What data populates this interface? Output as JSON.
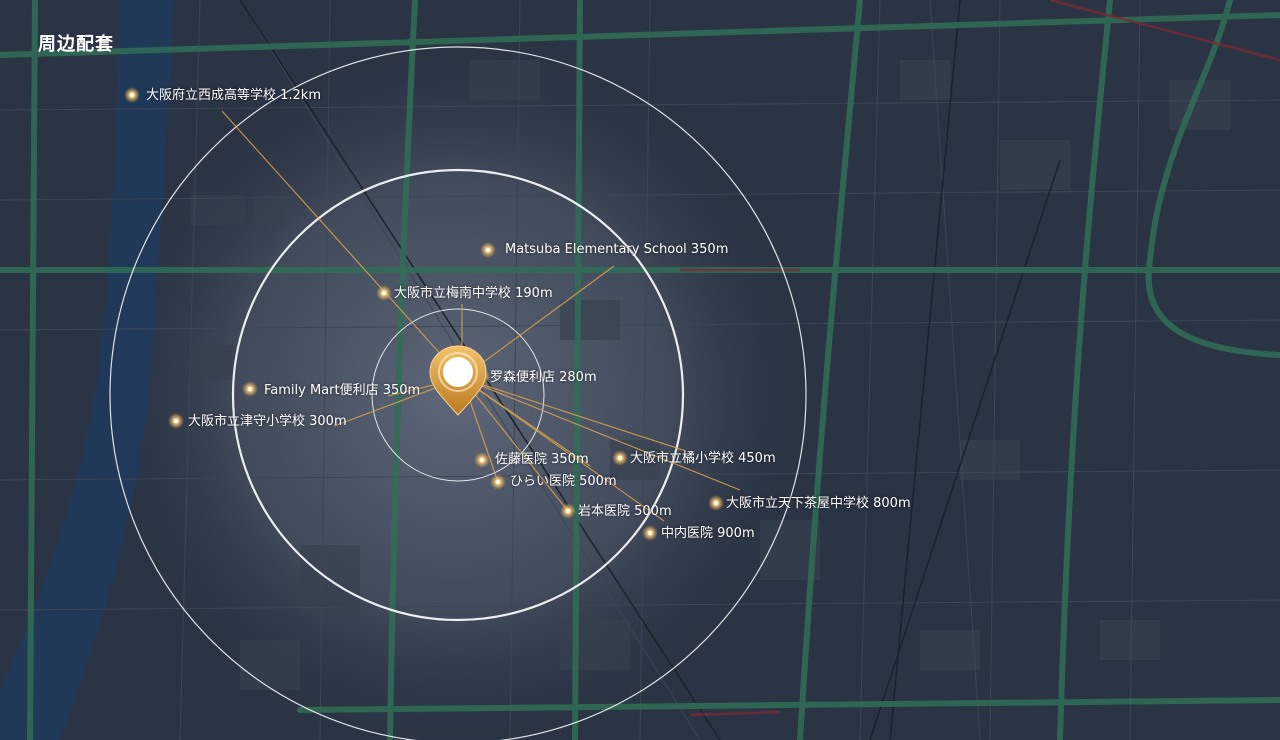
{
  "title": "周边配套",
  "colors": {
    "background": "#2b3444",
    "accent_gold": "#d9a24a",
    "ring": "#ffffff",
    "river": "#203a5c",
    "green_road": "#2f6e56"
  },
  "pois": [
    {
      "id": "school-seinan",
      "label": "大阪府立西成高等学校 1.2km"
    },
    {
      "id": "school-matsuba",
      "label": "Matsuba Elementary School 350m"
    },
    {
      "id": "school-umeminami",
      "label": "大阪市立梅南中学校 190m"
    },
    {
      "id": "store-morimori",
      "label": "罗森便利店 280m"
    },
    {
      "id": "store-familymart",
      "label": "Family Mart便利店 350m"
    },
    {
      "id": "school-tsumori",
      "label": "大阪市立津守小学校 300m"
    },
    {
      "id": "hospital-sato",
      "label": "佐藤医院 350m"
    },
    {
      "id": "school-tachibana",
      "label": "大阪市立橘小学校 450m"
    },
    {
      "id": "hospital-hirai",
      "label": "ひらい医院 500m"
    },
    {
      "id": "school-tengachaya",
      "label": "大阪市立天下茶屋中学校 800m"
    },
    {
      "id": "hospital-iwamoto",
      "label": "岩本医院 500m"
    },
    {
      "id": "hospital-nakauchi",
      "label": "中内医院 900m"
    }
  ]
}
